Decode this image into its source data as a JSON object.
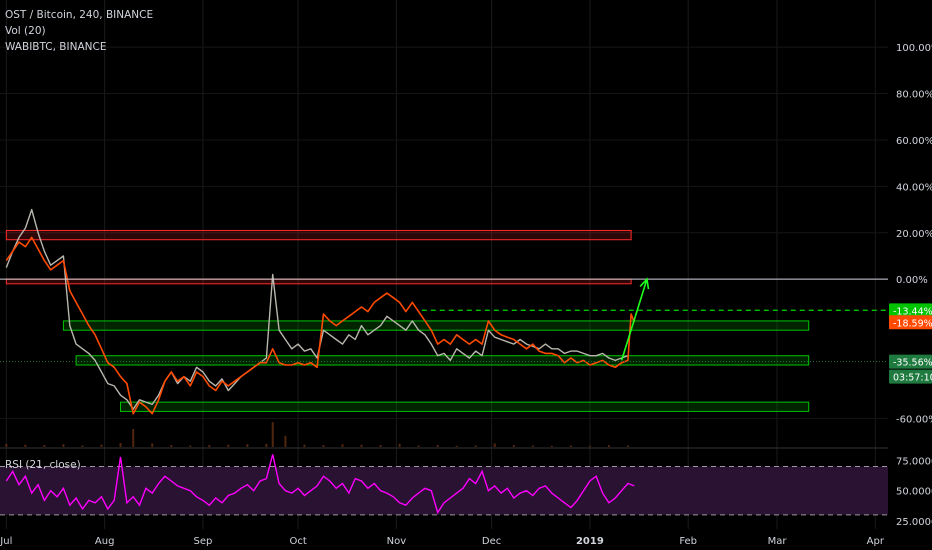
{
  "header": {
    "symbol_line": "OST / Bitcoin, 240, BINANCE",
    "volume_line": "Vol (20)",
    "compare_line": "WABIBTC, BINANCE"
  },
  "rsi_panel": {
    "title": "RSI (21, close)"
  },
  "colors": {
    "background": "#000000",
    "candles": "#b9b6ad",
    "compare_line": "#ff4a00",
    "rsi": "#ff00ff",
    "rsi_band": "#2a1233",
    "support_zone": "#00c400",
    "resistance_zone": "#ff2a2a",
    "target_arrow": "#1eff1e",
    "axis_text": "#d1d4dc"
  },
  "chart_data": [
    {
      "type": "line",
      "title": "OST / Bitcoin, 240, BINANCE",
      "y_scale": "percent",
      "ylim": [
        -64,
        113
      ],
      "y_ticks": [
        "100.00%",
        "80.00%",
        "60.00%",
        "40.00%",
        "20.00%",
        "0.00%",
        "-60.00%"
      ],
      "x_ticks": [
        "Jul",
        "Aug",
        "Sep",
        "Oct",
        "Nov",
        "Dec",
        "2019",
        "Feb",
        "Mar",
        "Apr"
      ],
      "x_tick_days": [
        0,
        31,
        62,
        92,
        123,
        153,
        184,
        215,
        243,
        274
      ],
      "x_range_days": [
        -2,
        278
      ],
      "series": [
        {
          "name": "OST / Bitcoin",
          "x": [
            0,
            2,
            4,
            6,
            8,
            10,
            12,
            14,
            16,
            18,
            20,
            22,
            24,
            26,
            28,
            30,
            32,
            34,
            36,
            38,
            40,
            42,
            44,
            46,
            48,
            50,
            52,
            54,
            56,
            58,
            60,
            62,
            64,
            66,
            68,
            70,
            72,
            74,
            76,
            78,
            80,
            82,
            84,
            86,
            88,
            90,
            92,
            94,
            96,
            98,
            100,
            102,
            104,
            106,
            108,
            110,
            112,
            114,
            116,
            118,
            120,
            122,
            124,
            126,
            128,
            130,
            132,
            134,
            136,
            138,
            140,
            142,
            144,
            146,
            148,
            150,
            152,
            154,
            156,
            158,
            160,
            162,
            164,
            166,
            168,
            170,
            172,
            174,
            176,
            178,
            180,
            182,
            184,
            186,
            188,
            190,
            192,
            194,
            196
          ],
          "values": [
            5,
            12,
            18,
            22,
            30,
            20,
            12,
            6,
            8,
            10,
            -20,
            -28,
            -30,
            -32,
            -35,
            -40,
            -45,
            -46,
            -50,
            -52,
            -56,
            -52,
            -53,
            -54,
            -50,
            -44,
            -40,
            -45,
            -42,
            -44,
            -38,
            -40,
            -44,
            -46,
            -43,
            -48,
            -45,
            -42,
            -40,
            -38,
            -36,
            -34,
            2,
            -22,
            -26,
            -30,
            -28,
            -31,
            -30,
            -34,
            -22,
            -24,
            -26,
            -28,
            -24,
            -26,
            -20,
            -24,
            -22,
            -20,
            -16,
            -18,
            -20,
            -22,
            -18,
            -22,
            -24,
            -28,
            -33,
            -32,
            -35,
            -30,
            -32,
            -34,
            -31,
            -33,
            -22,
            -25,
            -26,
            -27,
            -28,
            -26,
            -28,
            -29,
            -30,
            -28,
            -30,
            -30,
            -32,
            -31,
            -31,
            -32,
            -33,
            -33,
            -32,
            -34,
            -35,
            -34,
            -33
          ]
        },
        {
          "name": "WABIBTC, BINANCE",
          "x": [
            0,
            2,
            4,
            6,
            8,
            10,
            12,
            14,
            16,
            18,
            20,
            22,
            24,
            26,
            28,
            30,
            32,
            34,
            36,
            38,
            40,
            42,
            44,
            46,
            48,
            50,
            52,
            54,
            56,
            58,
            60,
            62,
            64,
            66,
            68,
            70,
            72,
            74,
            76,
            78,
            80,
            82,
            84,
            86,
            88,
            90,
            92,
            94,
            96,
            98,
            100,
            102,
            104,
            106,
            108,
            110,
            112,
            114,
            116,
            118,
            120,
            122,
            124,
            126,
            128,
            130,
            132,
            134,
            136,
            138,
            140,
            142,
            144,
            146,
            148,
            150,
            152,
            154,
            156,
            158,
            160,
            162,
            164,
            166,
            168,
            170,
            172,
            174,
            176,
            178,
            180,
            182,
            184,
            186,
            188,
            190,
            192,
            194,
            196,
            197,
            198
          ],
          "values": [
            8,
            12,
            16,
            14,
            18,
            13,
            8,
            4,
            6,
            8,
            -5,
            -10,
            -15,
            -20,
            -24,
            -30,
            -36,
            -38,
            -42,
            -45,
            -58,
            -53,
            -55,
            -58,
            -52,
            -44,
            -40,
            -44,
            -42,
            -46,
            -40,
            -42,
            -46,
            -48,
            -44,
            -46,
            -44,
            -42,
            -40,
            -38,
            -36,
            -36,
            -30,
            -36,
            -37,
            -37,
            -36,
            -37,
            -36,
            -38,
            -15,
            -18,
            -20,
            -18,
            -16,
            -14,
            -12,
            -14,
            -10,
            -8,
            -6,
            -8,
            -10,
            -14,
            -10,
            -14,
            -18,
            -22,
            -28,
            -26,
            -28,
            -24,
            -26,
            -28,
            -26,
            -28,
            -18,
            -22,
            -24,
            -25,
            -26,
            -28,
            -30,
            -28,
            -31,
            -32,
            -32,
            -33,
            -36,
            -34,
            -36,
            -35,
            -37,
            -36,
            -35,
            -37,
            -38,
            -36,
            -35,
            -15,
            -18.59
          ]
        }
      ],
      "volume": {
        "name": "Vol (20)",
        "x": [
          0,
          6,
          12,
          18,
          24,
          30,
          36,
          40,
          46,
          52,
          58,
          64,
          70,
          76,
          82,
          84,
          88,
          94,
          100,
          106,
          112,
          118,
          124,
          130,
          136,
          142,
          148,
          154,
          160,
          166,
          172,
          178,
          184,
          190,
          196
        ],
        "values": [
          8,
          6,
          5,
          7,
          4,
          6,
          10,
          45,
          9,
          5,
          4,
          5,
          6,
          7,
          8,
          62,
          28,
          6,
          5,
          7,
          6,
          5,
          8,
          4,
          5,
          3,
          4,
          9,
          5,
          4,
          3,
          4,
          3,
          5,
          4
        ]
      },
      "zones": [
        {
          "kind": "resistance",
          "from_day": 0,
          "to_day": 197,
          "low": 17,
          "high": 21
        },
        {
          "kind": "resistance",
          "from_day": 0,
          "to_day": 197,
          "low": -2,
          "high": 0
        },
        {
          "kind": "support",
          "from_day": 18,
          "to_day": 253,
          "low": -22,
          "high": -18
        },
        {
          "kind": "support",
          "from_day": 22,
          "to_day": 253,
          "low": -37,
          "high": -33
        },
        {
          "kind": "support",
          "from_day": 36,
          "to_day": 253,
          "low": -57,
          "high": -53
        }
      ],
      "reference_lines": [
        {
          "kind": "zero",
          "value": 0
        },
        {
          "kind": "dashed-green",
          "value": -13.44,
          "from_day": 131
        },
        {
          "kind": "dotted-current",
          "value": -35.56
        }
      ],
      "arrow": {
        "from_day": 194,
        "from_value": -35,
        "to_day": 202,
        "to_value": 0
      },
      "price_labels": [
        {
          "text": "-13.44%",
          "value": -13.44,
          "color": "#00c400"
        },
        {
          "text": "-18.59%",
          "value": -18.59,
          "color": "#ff4a00"
        },
        {
          "text": "-35.56%",
          "value": -35.56,
          "color": "#1f7a3f"
        },
        {
          "text": "03:57:10",
          "value": -42,
          "color": "#1f7a3f"
        }
      ]
    },
    {
      "type": "line",
      "title": "RSI (21, close)",
      "ylim": [
        20,
        82
      ],
      "y_ticks": [
        "75.0000",
        "50.0000",
        "25.0000"
      ],
      "bands": [
        30,
        70
      ],
      "series": [
        {
          "name": "RSI (21, close)",
          "x": [
            0,
            2,
            4,
            6,
            8,
            10,
            12,
            14,
            16,
            18,
            20,
            22,
            24,
            26,
            28,
            30,
            32,
            34,
            36,
            38,
            40,
            42,
            44,
            46,
            48,
            50,
            52,
            54,
            56,
            58,
            60,
            62,
            64,
            66,
            68,
            70,
            72,
            74,
            76,
            78,
            80,
            82,
            84,
            86,
            88,
            90,
            92,
            94,
            96,
            98,
            100,
            102,
            104,
            106,
            108,
            110,
            112,
            114,
            116,
            118,
            120,
            122,
            124,
            126,
            128,
            130,
            132,
            134,
            136,
            138,
            140,
            142,
            144,
            146,
            148,
            150,
            152,
            154,
            156,
            158,
            160,
            162,
            164,
            166,
            168,
            170,
            172,
            174,
            176,
            178,
            180,
            182,
            184,
            186,
            188,
            190,
            192,
            194,
            196,
            198
          ],
          "values": [
            58,
            66,
            55,
            62,
            48,
            55,
            42,
            50,
            45,
            52,
            38,
            44,
            35,
            42,
            40,
            45,
            35,
            42,
            78,
            40,
            45,
            38,
            52,
            48,
            56,
            62,
            58,
            54,
            52,
            50,
            45,
            42,
            38,
            44,
            40,
            46,
            48,
            52,
            55,
            50,
            58,
            60,
            80,
            56,
            50,
            48,
            52,
            46,
            50,
            54,
            62,
            58,
            52,
            56,
            48,
            60,
            58,
            52,
            56,
            50,
            48,
            45,
            40,
            38,
            44,
            48,
            52,
            50,
            32,
            40,
            44,
            48,
            52,
            60,
            56,
            66,
            50,
            54,
            48,
            52,
            44,
            48,
            50,
            46,
            52,
            54,
            48,
            44,
            40,
            36,
            42,
            50,
            58,
            62,
            48,
            40,
            44,
            50,
            56,
            54
          ]
        }
      ]
    }
  ]
}
